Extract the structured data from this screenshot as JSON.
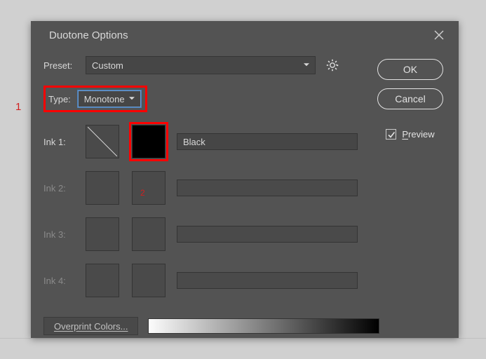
{
  "dialog": {
    "title": "Duotone Options",
    "preset_label": "Preset:",
    "preset_value": "Custom",
    "type_label": "Type:",
    "type_value": "Monotone",
    "inks": [
      {
        "label": "Ink 1:",
        "name": "Black",
        "enabled": true
      },
      {
        "label": "Ink 2:",
        "name": "",
        "enabled": false
      },
      {
        "label": "Ink 3:",
        "name": "",
        "enabled": false
      },
      {
        "label": "Ink 4:",
        "name": "",
        "enabled": false
      }
    ],
    "overprint_label": "Overprint Colors...",
    "buttons": {
      "ok": "OK",
      "cancel": "Cancel"
    },
    "preview_label": "Preview",
    "preview_checked": true
  },
  "annotations": {
    "a1": "1",
    "a2": "2"
  }
}
